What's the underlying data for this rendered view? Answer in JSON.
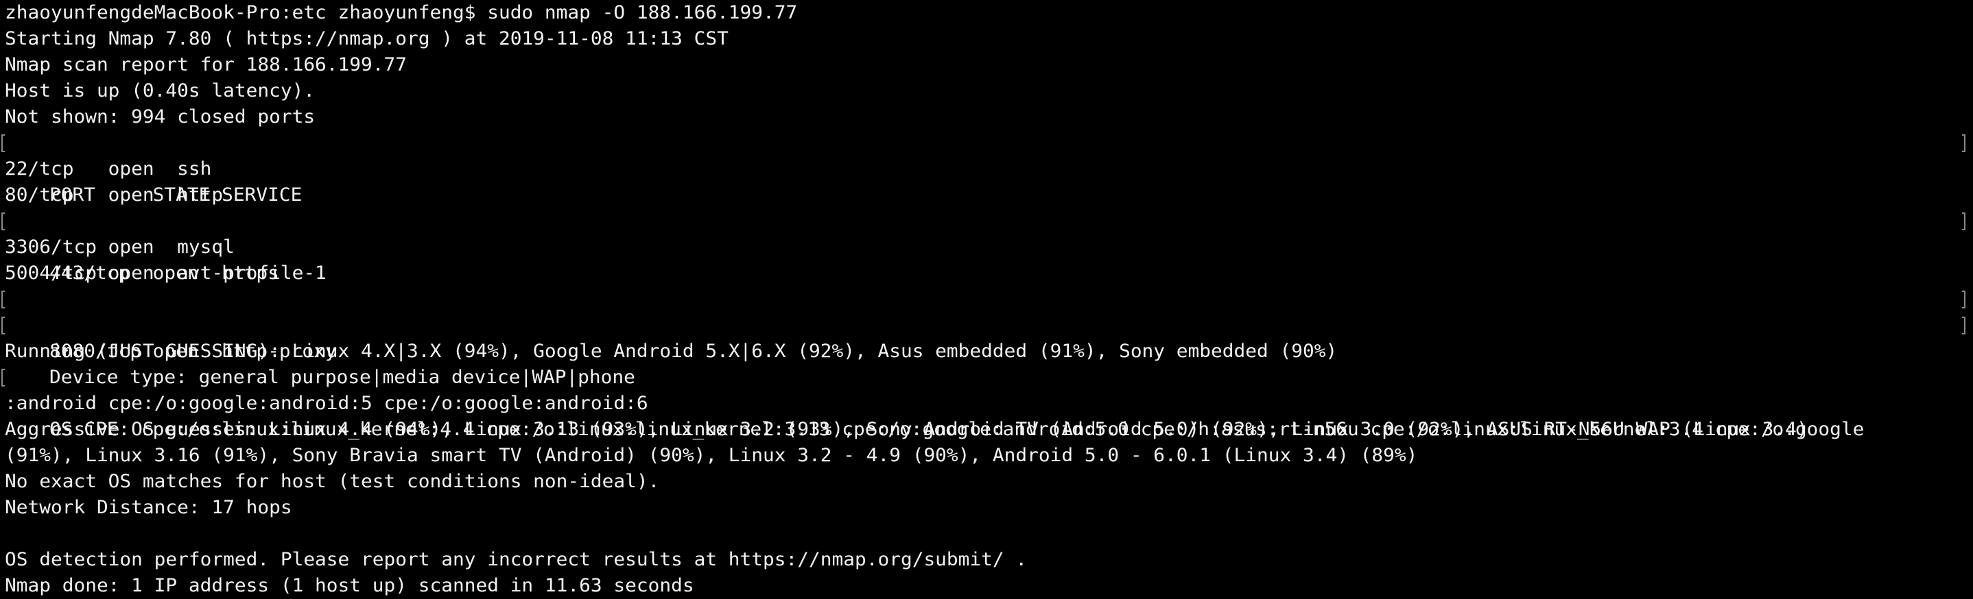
{
  "terminal": {
    "background": "#000000",
    "foreground": "#f2f2f2",
    "lines": [
      "zhaoyunfengdeMacBook-Pro:etc zhaoyunfeng$ sudo nmap -O 188.166.199.77",
      "Starting Nmap 7.80 ( https://nmap.org ) at 2019-11-08 11:13 CST",
      "Nmap scan report for 188.166.199.77",
      "Host is up (0.40s latency).",
      "Not shown: 994 closed ports",
      "PORT     STATE SERVICE",
      "22/tcp   open  ssh",
      "80/tcp   open  http",
      "443/tcp  open  https",
      "3306/tcp open  mysql",
      "5004/tcp open  avt-profile-1",
      "8080/tcp open  http-proxy",
      "Device type: general purpose|media device|WAP|phone",
      "Running (JUST GUESSING): Linux 4.X|3.X (94%), Google Android 5.X|6.X (92%), Asus embedded (91%), Sony embedded (90%)",
      "OS CPE: cpe:/o:linux:linux_kernel:4.4 cpe:/o:linux:linux_kernel:3.13 cpe:/o:google:android:5.0 cpe:/h:asus:rt-n56u cpe:/o:linux:linux_kernel:3.4 cpe:/o:google",
      ":android cpe:/o:google:android:5 cpe:/o:google:android:6",
      "Aggressive OS guesses: Linux 4.4 (94%), Linux 3.13 (93%), Linux 3.2 (93%), Sony Android TV (Android 5.0) (92%), Linux 3.0 (92%), ASUS RT-N56U WAP (Linux 3.4)",
      "(91%), Linux 3.16 (91%), Sony Bravia smart TV (Android) (90%), Linux 3.2 - 4.9 (90%), Android 5.0 - 6.0.1 (Linux 3.4) (89%)",
      "No exact OS matches for host (test conditions non-ideal).",
      "Network Distance: 17 hops",
      "",
      "OS detection performed. Please report any incorrect results at https://nmap.org/submit/ .",
      "Nmap done: 1 IP address (1 host up) scanned in 11.63 seconds"
    ]
  }
}
